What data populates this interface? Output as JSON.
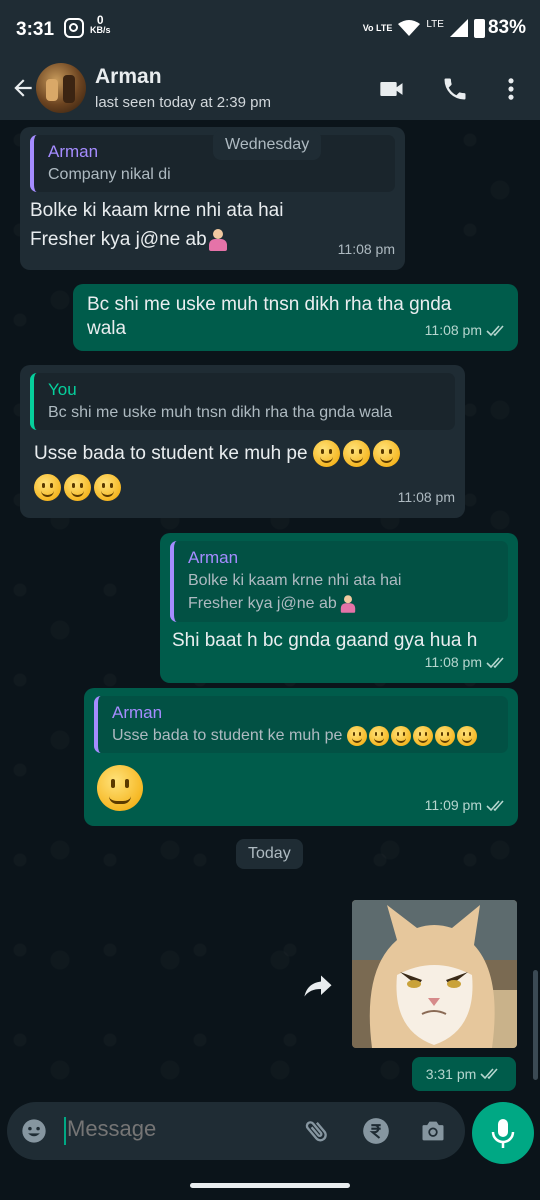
{
  "status_bar": {
    "time": "3:31",
    "net_speed_value": "0",
    "net_speed_unit": "KB/s",
    "volte": "Vo LTE",
    "lte": "LTE",
    "battery": "83%"
  },
  "header": {
    "contact_name": "Arman",
    "last_seen": "last seen today at 2:39 pm"
  },
  "messages": [
    {
      "direction": "incoming",
      "reply_to": {
        "name": "Arman",
        "text": "Company nikal di"
      },
      "lines": [
        "Bolke ki kaam krne nhi ata hai",
        "Fresher kya j@ne ab"
      ],
      "time": "11:08 pm"
    },
    {
      "direction": "outgoing",
      "lines": [
        "Bc shi me uske muh tnsn dikh rha tha gnda",
        "wala"
      ],
      "time": "11:08 pm"
    },
    {
      "direction": "incoming",
      "reply_to": {
        "name": "You",
        "text": "Bc shi me uske muh tnsn dikh rha tha gnda wala"
      },
      "text": "Usse bada to student ke muh pe",
      "time": "11:08 pm"
    },
    {
      "direction": "outgoing",
      "reply_to": {
        "name": "Arman",
        "line1": "Bolke ki kaam krne nhi ata hai",
        "line2": "Fresher kya j@ne ab"
      },
      "text": "Shi baat h bc gnda gaand gya hua h",
      "time": "11:08 pm"
    },
    {
      "direction": "outgoing",
      "reply_to": {
        "name": "Arman",
        "text": "Usse bada to student ke muh pe"
      },
      "time": "11:09 pm"
    }
  ],
  "date_chips": [
    "Wednesday",
    "Today"
  ],
  "image_message": {
    "time": "3:31 pm"
  },
  "input": {
    "placeholder": "Message"
  },
  "colors": {
    "header_bg": "#1f2c34",
    "chat_bg": "#0b141a",
    "incoming_bubble": "#1f2c34",
    "outgoing_bubble": "#005c4b",
    "accent": "#00a884",
    "quote_name": "#a58cff",
    "you_name": "#06cf9c"
  },
  "icons": [
    "back-arrow-icon",
    "video-call-icon",
    "phone-icon",
    "more-vert-icon",
    "emoji-icon",
    "attach-icon",
    "rupee-payment-icon",
    "camera-icon",
    "mic-icon",
    "forward-icon",
    "double-tick-icon",
    "smiley-emoji",
    "person-shrugging-emoji"
  ]
}
